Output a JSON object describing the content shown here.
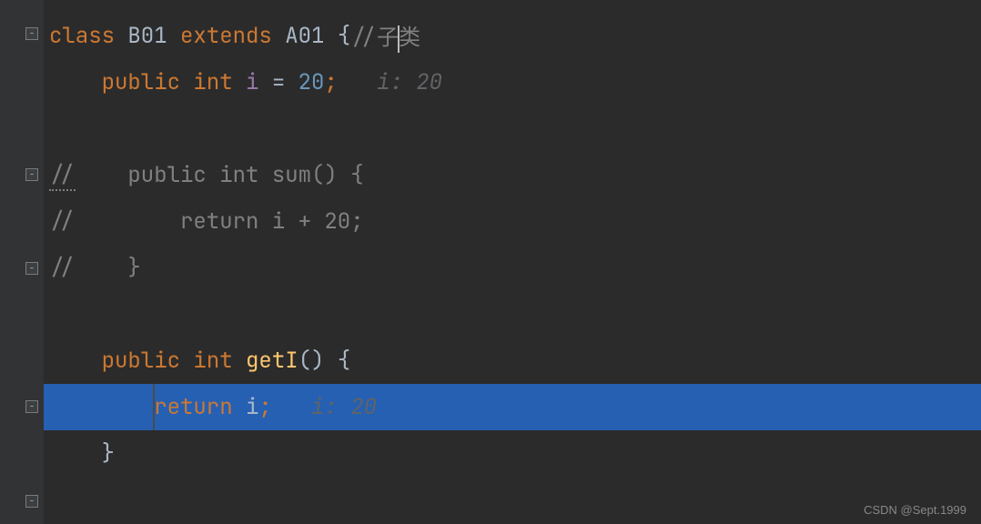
{
  "code": {
    "line1": {
      "class_kw": "class",
      "class_name": "B01",
      "extends_kw": "extends",
      "super_name": "A01",
      "brace": "{",
      "comment": "//子类"
    },
    "line2": {
      "public_kw": "public",
      "int_kw": "int",
      "identifier": "i",
      "equals": "=",
      "value": "20",
      "semicolon": ";",
      "hint": "i: 20"
    },
    "line4": {
      "comment": "//    public int sum() {"
    },
    "line5": {
      "comment": "//        return i + 20;"
    },
    "line6": {
      "comment": "//    }"
    },
    "line8": {
      "public_kw": "public",
      "int_kw": "int",
      "method_name": "getI",
      "parens": "()",
      "brace": "{"
    },
    "line9": {
      "return_kw": "return",
      "identifier": "i",
      "semicolon": ";",
      "hint": "i: 20"
    },
    "line10": {
      "brace": "}"
    }
  },
  "watermark": "CSDN @Sept.1999"
}
